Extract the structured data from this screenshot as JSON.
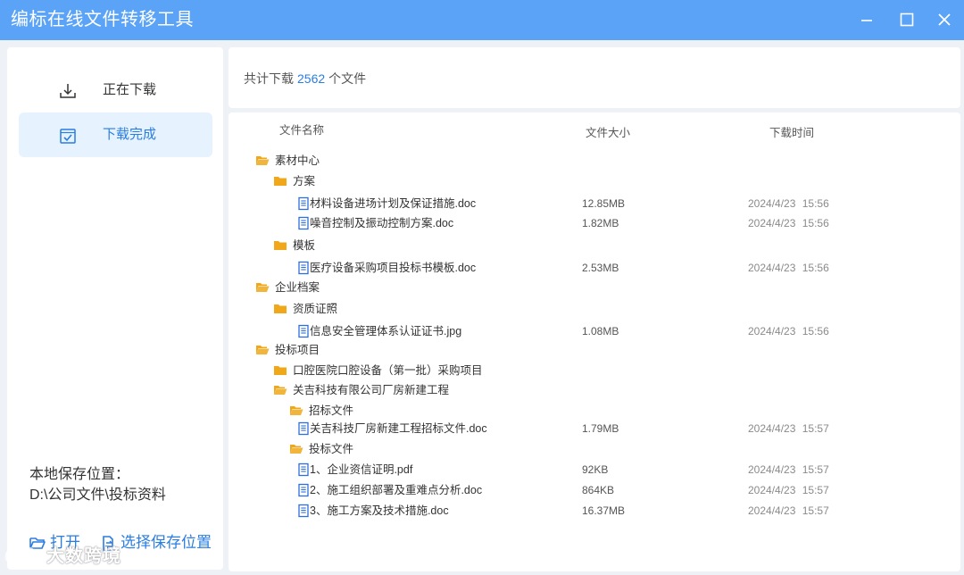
{
  "window": {
    "title": "编标在线文件转移工具",
    "accent": "#5ba3f7"
  },
  "sidebar": {
    "items": [
      {
        "label": "正在下载",
        "icon": "download-tray-icon"
      },
      {
        "label": "下载完成",
        "icon": "check-box-icon"
      }
    ],
    "save_location_label": "本地保存位置：",
    "save_location_path": "D:\\公司文件\\投标资料",
    "open_label": "打开",
    "choose_location_label": "选择保存位置"
  },
  "summary": {
    "prefix": "共计下载",
    "count": "2562",
    "suffix": "个文件"
  },
  "table": {
    "headers": {
      "name": "文件名称",
      "size": "文件大小",
      "time": "下载时间"
    },
    "rows": [
      {
        "type": "folder-open",
        "name": "素材中心",
        "size": "",
        "time": ""
      },
      {
        "type": "folder",
        "name": "方案",
        "size": "",
        "time": ""
      },
      {
        "type": "file",
        "name": "材料设备进场计划及保证措施.doc",
        "size": "12.85MB",
        "time": "2024/4/23 15:56"
      },
      {
        "type": "file",
        "name": "噪音控制及振动控制方案.doc",
        "size": "1.82MB",
        "time": "2024/4/23 15:56"
      },
      {
        "type": "folder",
        "name": "模板",
        "size": "",
        "time": ""
      },
      {
        "type": "file",
        "name": "医疗设备采购项目投标书模板.doc",
        "size": "2.53MB",
        "time": "2024/4/23 15:56"
      },
      {
        "type": "folder-open",
        "name": "企业档案",
        "size": "",
        "time": ""
      },
      {
        "type": "folder",
        "name": "资质证照",
        "size": "",
        "time": ""
      },
      {
        "type": "file",
        "name": "信息安全管理体系认证证书.jpg",
        "size": "1.08MB",
        "time": "2024/4/23 15:56"
      },
      {
        "type": "folder-open",
        "name": "投标项目",
        "size": "",
        "time": ""
      },
      {
        "type": "folder",
        "name": "口腔医院口腔设备（第一批）采购项目",
        "size": "",
        "time": ""
      },
      {
        "type": "folder-open",
        "name": "关吉科技有限公司厂房新建工程",
        "size": "",
        "time": ""
      },
      {
        "type": "folder-open",
        "name": "招标文件",
        "size": "",
        "time": ""
      },
      {
        "type": "file",
        "name": "关吉科技厂房新建工程招标文件.doc",
        "size": "1.79MB",
        "time": "2024/4/23 15:57"
      },
      {
        "type": "folder-open",
        "name": "投标文件",
        "size": "",
        "time": ""
      },
      {
        "type": "file",
        "name": "1、企业资信证明.pdf",
        "size": "92KB",
        "time": "2024/4/23 15:57"
      },
      {
        "type": "file",
        "name": "2、施工组织部署及重难点分析.doc",
        "size": "864KB",
        "time": "2024/4/23 15:57"
      },
      {
        "type": "file",
        "name": "3、施工方案及技术措施.doc",
        "size": "16.37MB",
        "time": "2024/4/23 15:57"
      }
    ]
  },
  "watermark": {
    "text": "大数跨境"
  },
  "colors": {
    "folder": "#f0a81a",
    "file": "#2f6ed8",
    "link": "#2a7de1"
  }
}
